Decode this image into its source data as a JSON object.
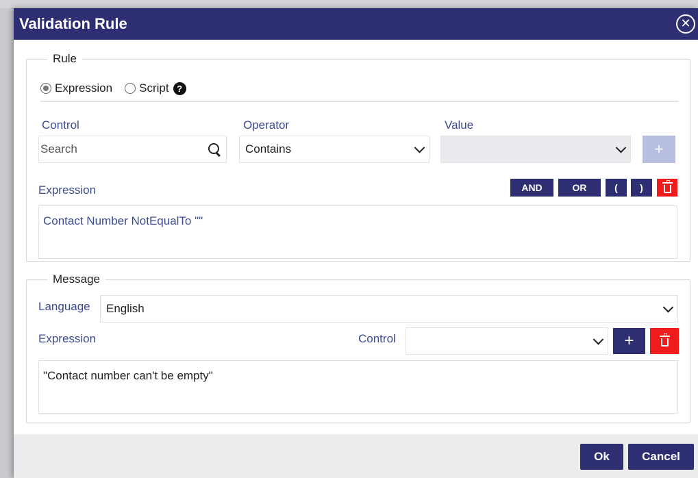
{
  "dialog": {
    "title": "Validation Rule",
    "close_icon": "close-circle-icon"
  },
  "rule": {
    "legend": "Rule",
    "mode_options": [
      {
        "label": "Expression",
        "checked": true
      },
      {
        "label": "Script",
        "checked": false
      }
    ],
    "help_glyph": "?",
    "control_label": "Control",
    "control_search_placeholder": "Search",
    "operator_label": "Operator",
    "operator_value": "Contains",
    "value_label": "Value",
    "value_value": "",
    "add_symbol": "+",
    "expression_label": "Expression",
    "buttons": {
      "and": "AND",
      "or": "OR",
      "open_paren": "(",
      "close_paren": ")"
    },
    "expression_text": "Contact Number NotEqualTo \"\""
  },
  "message": {
    "legend": "Message",
    "language_label": "Language",
    "language_value": "English",
    "expression_label": "Expression",
    "control_label": "Control",
    "control_value": "",
    "add_symbol": "+",
    "message_text": "\"Contact number can't be empty\""
  },
  "footer": {
    "ok_label": "Ok",
    "cancel_label": "Cancel"
  },
  "colors": {
    "accent_navy": "#2e2f72",
    "danger_red": "#ee1c1c",
    "label_blue": "#3d4b8f"
  }
}
